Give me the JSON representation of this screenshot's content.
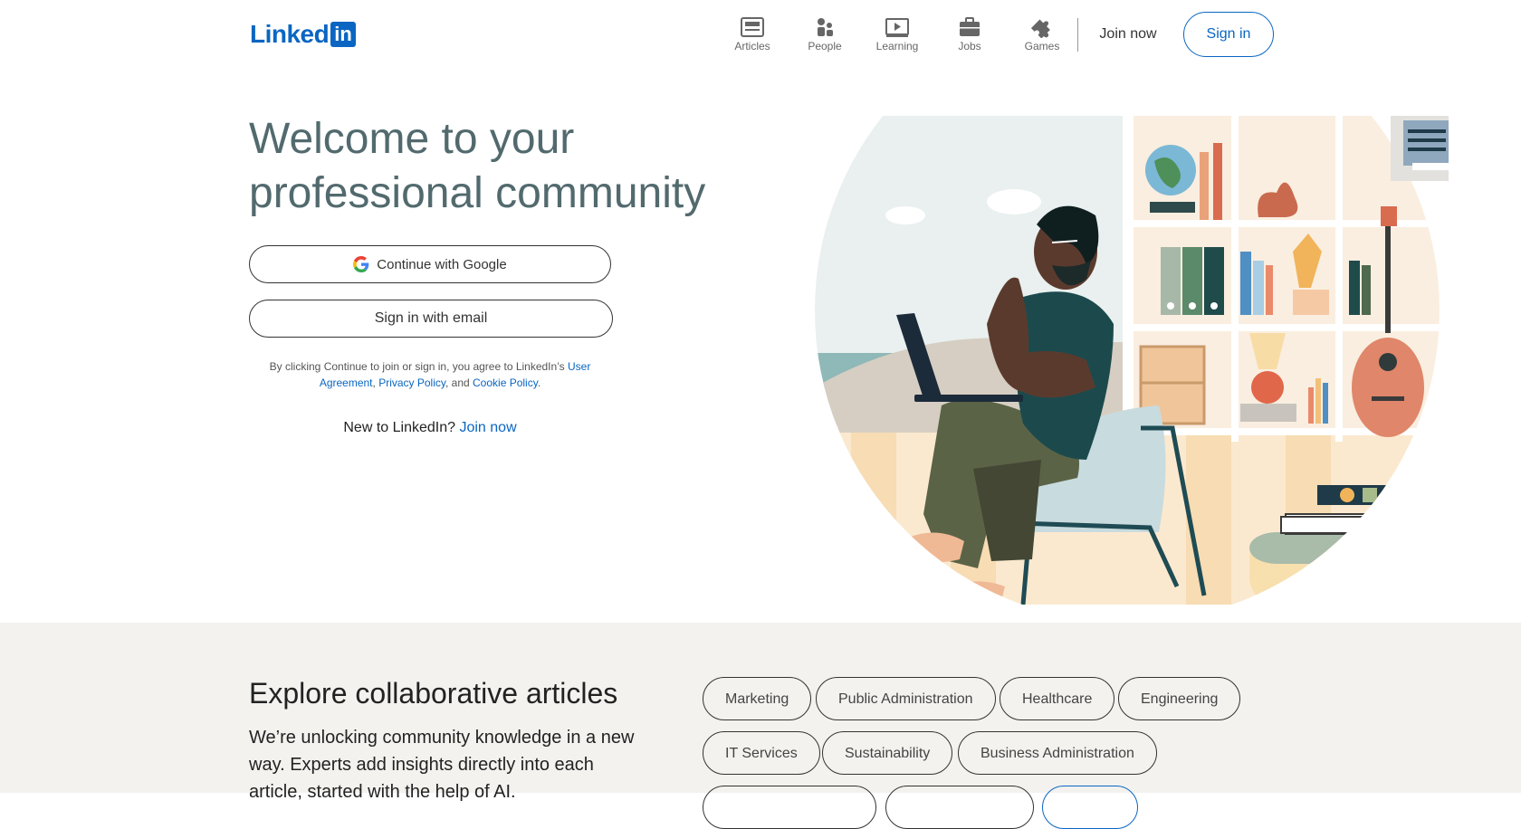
{
  "header": {
    "logo": {
      "word": "Linked",
      "box": "in"
    },
    "nav": [
      {
        "label": "Articles",
        "icon": "articles-icon"
      },
      {
        "label": "People",
        "icon": "people-icon"
      },
      {
        "label": "Learning",
        "icon": "learning-icon"
      },
      {
        "label": "Jobs",
        "icon": "jobs-icon"
      },
      {
        "label": "Games",
        "icon": "games-icon"
      }
    ],
    "join_now": "Join now",
    "sign_in": "Sign in"
  },
  "hero": {
    "title": "Welcome to your professional community",
    "google_button": "Continue with Google",
    "email_button": "Sign in with email",
    "legal": {
      "prefix": "By clicking Continue to join or sign in, you agree to LinkedIn’s ",
      "user_agreement": "User Agreement",
      "sep1": ", ",
      "privacy_policy": "Privacy Policy",
      "sep2": ", and ",
      "cookie_policy": "Cookie Policy",
      "suffix": "."
    },
    "new_to": "New to LinkedIn?",
    "join_link": "Join now"
  },
  "explore": {
    "title": "Explore collaborative articles",
    "description": "We’re unlocking community knowledge in a new way. Experts add insights directly into each article, started with the help of AI.",
    "topics": [
      "Marketing",
      "Public Administration",
      "Healthcare",
      "Engineering",
      "IT Services",
      "Sustainability",
      "Business Administration"
    ]
  },
  "colors": {
    "brand": "#0a66c2",
    "title": "#526a6e",
    "section_bg": "#f3f2ef"
  }
}
